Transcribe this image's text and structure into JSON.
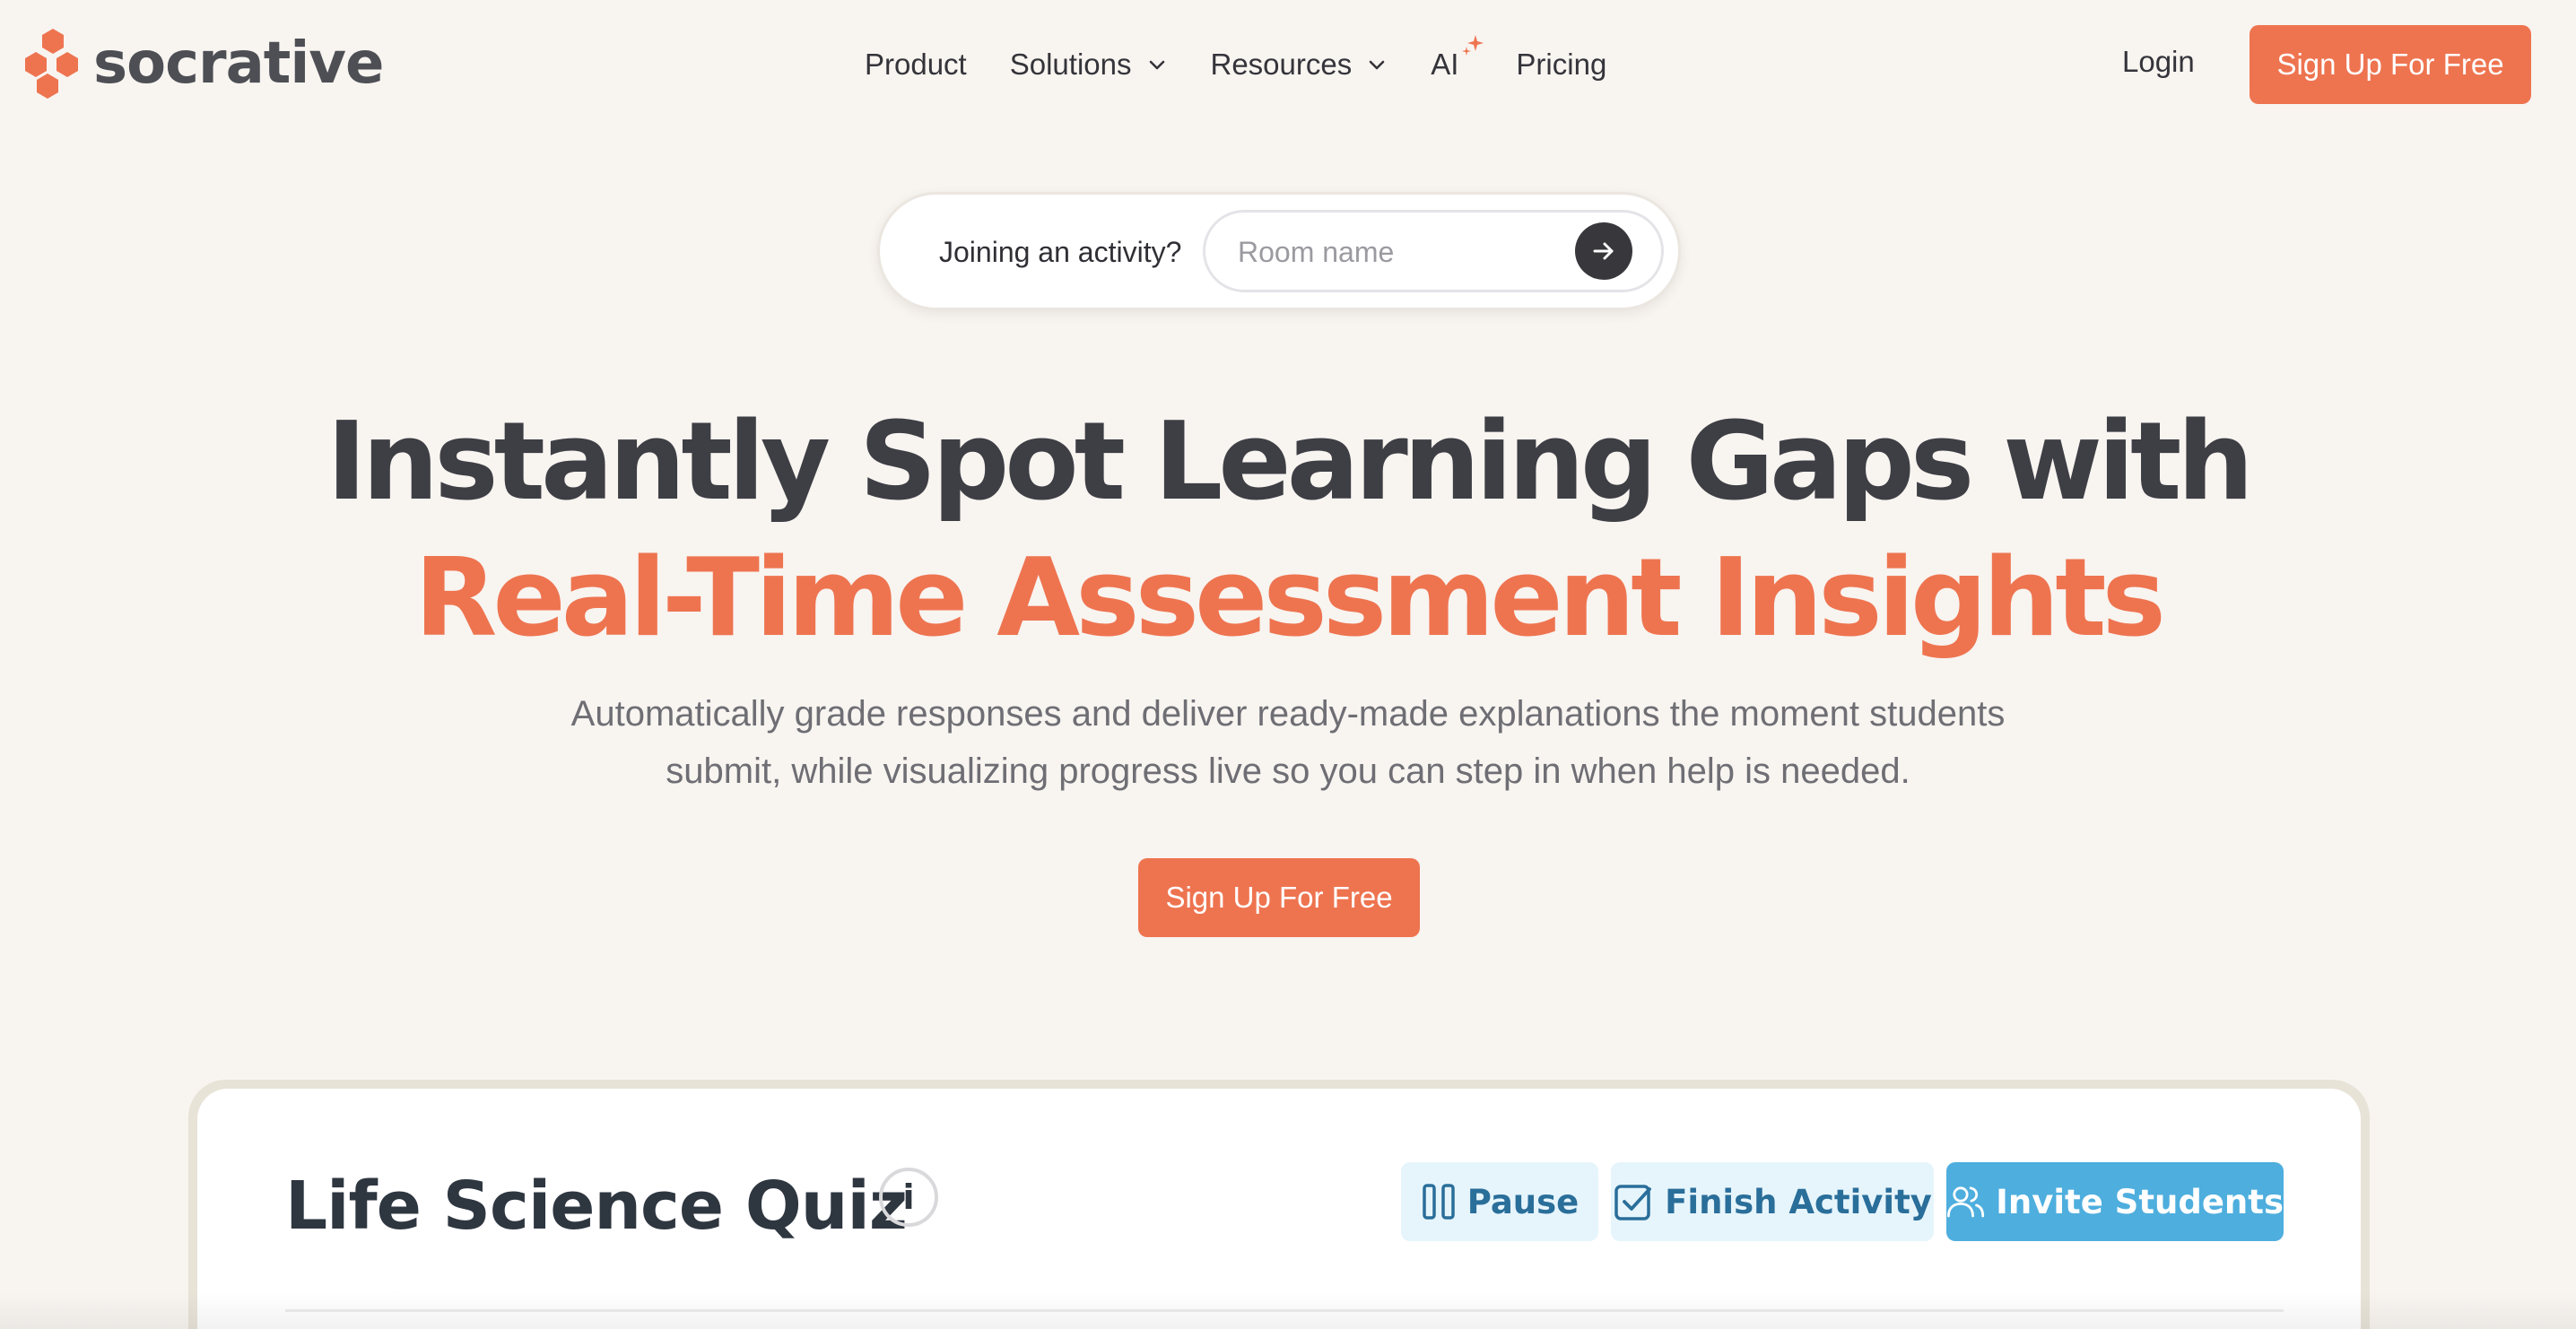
{
  "brand": {
    "name": "socrative",
    "accent": "#ee7450"
  },
  "nav": {
    "items": [
      {
        "label": "Product"
      },
      {
        "label": "Solutions"
      },
      {
        "label": "Resources"
      },
      {
        "label": "AI"
      },
      {
        "label": "Pricing"
      }
    ],
    "login": "Login",
    "signup": "Sign Up For Free"
  },
  "join": {
    "label": "Joining an activity?",
    "placeholder": "Room name",
    "value": ""
  },
  "hero": {
    "title_line1": "Instantly Spot Learning Gaps with",
    "title_line2": "Real-Time Assessment Insights",
    "subtitle": "Automatically grade responses and deliver ready-made explanations the moment students submit, while visualizing progress live so you can step in when help is needed.",
    "cta": "Sign Up For Free"
  },
  "dashboard": {
    "title": "Life Science Quiz",
    "info": "i",
    "pause": "Pause",
    "finish": "Finish Activity",
    "invite": "Invite Students"
  }
}
